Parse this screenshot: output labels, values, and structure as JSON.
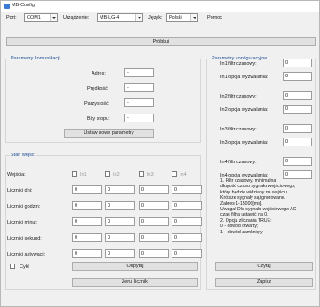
{
  "window": {
    "title": "MB-Config"
  },
  "toolbar": {
    "port_label": "Port:",
    "port_value": "COM1",
    "device_label": "Urządzenie:",
    "device_value": "MB-LG-4",
    "language_label": "Język:",
    "language_value": "Polski",
    "help_label": "Pomoc"
  },
  "probe_button": "Próbkuj",
  "comm": {
    "title": "Parametry komunikacji",
    "address_label": "Adres:",
    "address_value": "-",
    "speed_label": "Prędkość:",
    "speed_value": "-",
    "parity_label": "Parzystość:",
    "parity_value": "-",
    "stopbits_label": "Bity stopu:",
    "stopbits_value": "-",
    "set_button": "Ustaw nowe parametry"
  },
  "inputs": {
    "title": "Stan wejść",
    "inputs_label": "Wejścia:",
    "columns": [
      "In1",
      "In2",
      "In3",
      "In4"
    ],
    "rows": [
      {
        "label": "Liczniki dni:",
        "values": [
          "0",
          "0",
          "0",
          "0"
        ]
      },
      {
        "label": "Liczniki godzin:",
        "values": [
          "0",
          "0",
          "0",
          "0"
        ]
      },
      {
        "label": "Liczniki minut:",
        "values": [
          "0",
          "0",
          "0",
          "0"
        ]
      },
      {
        "label": "Liczniki sekund:",
        "values": [
          "0",
          "0",
          "0",
          "0"
        ]
      },
      {
        "label": "Liczniki aktywacji:",
        "values": [
          "0",
          "0",
          "0",
          "0"
        ]
      }
    ],
    "cycle_label": "Cykl",
    "read_button": "Odpytaj",
    "reset_button": "Zeruj liczniki"
  },
  "config": {
    "title": "Parametry konfiguracyjne",
    "fields": [
      {
        "label": "In1 filtr czasowy:",
        "value": "0"
      },
      {
        "label": "In1 opcja wyzwalania:",
        "value": "0"
      },
      {
        "label": "In2 filtr czasowy:",
        "value": "0"
      },
      {
        "label": "In2 opcja wyzwalania:",
        "value": "0"
      },
      {
        "label": "In3 filtr czasowy:",
        "value": "0"
      },
      {
        "label": "In3 opcja wyzwalania:",
        "value": "0"
      },
      {
        "label": "In4 filtr czasowy:",
        "value": "0"
      },
      {
        "label": "In4 opcja wyzwalania:",
        "value": "0"
      }
    ],
    "description": "1. Filtr czasowy: minimalna\ndługość czasu sygnału wejściowego,\nktóry będzie widziany na wejściu.\nKrótsze sygnały są ignorowane.\nZakres 1-15000[ms].\nUwaga! Dla sygnału wejściowego AC\nczas filtra ustawić na 0.\n2. Opcja zliczania TRUE:\n0 - obwód otwarty;\n1 - obwód zamknięty",
    "read_button": "Czytaj",
    "write_button": "Zapisz"
  }
}
